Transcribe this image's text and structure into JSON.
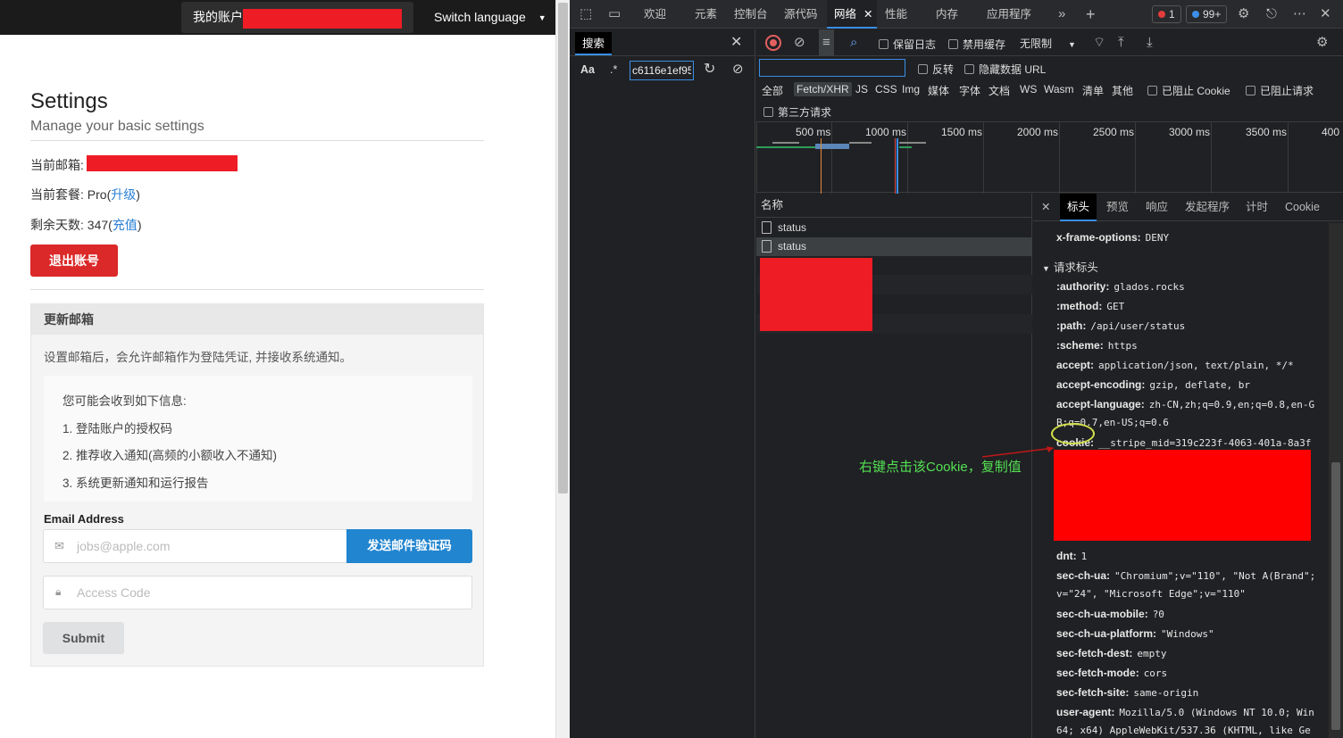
{
  "site": {
    "account_label": "我的账户",
    "switch_language": "Switch language",
    "title": "Settings",
    "subtitle": "Manage your basic settings",
    "current_email_label": "当前邮箱:",
    "current_plan_label": "当前套餐: Pro(",
    "upgrade_link": "升级",
    "close_paren": ")",
    "days_left_label": "剩余天数: 347(",
    "recharge_link": "充值",
    "logout_button": "退出账号",
    "panel_title": "更新邮箱",
    "panel_desc": "设置邮箱后，会允许邮箱作为登陆凭证, 并接收系统通知。",
    "info_title": "您可能会收到如下信息:",
    "info_items": [
      "1. 登陆账户的授权码",
      "2. 推荐收入通知(高频的小额收入不通知)",
      "3. 系统更新通知和运行报告"
    ],
    "email_label": "Email Address",
    "email_placeholder": "jobs@apple.com",
    "send_code_button": "发送邮件验证码",
    "code_placeholder": "Access Code",
    "submit_button": "Submit"
  },
  "devtools": {
    "tabs": [
      "欢迎",
      "元素",
      "控制台",
      "源代码",
      "网络",
      "性能",
      "内存",
      "应用程序"
    ],
    "error_count": "1",
    "message_count": "99+",
    "search_tab": "搜索",
    "search_aa": "Aa",
    "search_regex": ".*",
    "search_value": "c6116e1ef95",
    "toolbar": {
      "preserve_log": "保留日志",
      "disable_cache": "禁用缓存",
      "throttle": "无限制"
    },
    "filter": {
      "invert": "反转",
      "hide_data_urls": "隐藏数据 URL",
      "third_party": "第三方请求",
      "blocked_cookies": "已阻止 Cookie",
      "blocked_requests": "已阻止请求"
    },
    "types": [
      "全部",
      "Fetch/XHR",
      "JS",
      "CSS",
      "Img",
      "媒体",
      "字体",
      "文档",
      "WS",
      "Wasm",
      "清单",
      "其他"
    ],
    "timeline_ticks": [
      "500 ms",
      "1000 ms",
      "1500 ms",
      "2000 ms",
      "2500 ms",
      "3000 ms",
      "3500 ms",
      "400"
    ],
    "name_column": "名称",
    "requests": [
      "status",
      "status"
    ],
    "detail_tabs": [
      "标头",
      "预览",
      "响应",
      "发起程序",
      "计时",
      "Cookie"
    ],
    "headers_top": {
      "key": "x-frame-options:",
      "value": "DENY"
    },
    "section_title": "请求标头",
    "request_headers": [
      {
        "key": ":authority:",
        "value": "glados.rocks"
      },
      {
        "key": ":method:",
        "value": "GET"
      },
      {
        "key": ":path:",
        "value": "/api/user/status"
      },
      {
        "key": ":scheme:",
        "value": "https"
      },
      {
        "key": "accept:",
        "value": "application/json, text/plain, */*"
      },
      {
        "key": "accept-encoding:",
        "value": "gzip, deflate, br"
      },
      {
        "key": "accept-language:",
        "value": "zh-CN,zh;q=0.9,en;q=0.8,en-G"
      },
      {
        "key": "",
        "value": "B;q=0.7,en-US;q=0.6"
      },
      {
        "key": "cookie:",
        "value": "__stripe_mid=319c223f-4063-401a-8a3f"
      }
    ],
    "request_headers_2": [
      {
        "key": "dnt:",
        "value": "1"
      },
      {
        "key": "sec-ch-ua:",
        "value": "\"Chromium\";v=\"110\", \"Not A(Brand\";"
      },
      {
        "key": "",
        "value": "v=\"24\", \"Microsoft Edge\";v=\"110\""
      },
      {
        "key": "sec-ch-ua-mobile:",
        "value": "?0"
      },
      {
        "key": "sec-ch-ua-platform:",
        "value": "\"Windows\""
      },
      {
        "key": "sec-fetch-dest:",
        "value": "empty"
      },
      {
        "key": "sec-fetch-mode:",
        "value": "cors"
      },
      {
        "key": "sec-fetch-site:",
        "value": "same-origin"
      },
      {
        "key": "user-agent:",
        "value": "Mozilla/5.0 (Windows NT 10.0; Win"
      },
      {
        "key": "",
        "value": "64; x64) AppleWebKit/537.36 (KHTML, like Ge"
      }
    ]
  },
  "annotation": "右键点击该Cookie，复制值"
}
